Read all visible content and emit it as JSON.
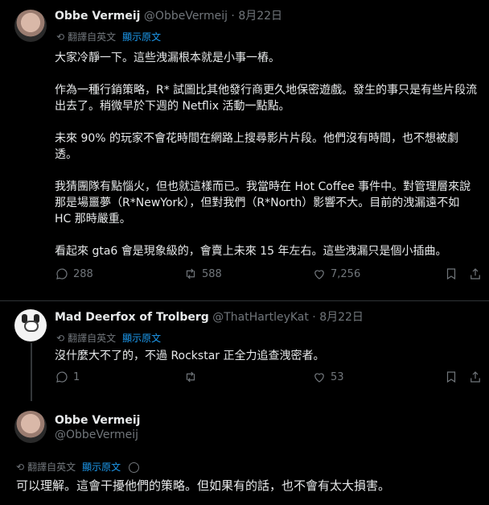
{
  "tweet1": {
    "name": "Obbe Vermeij",
    "handle": "@ObbeVermeij · 8月22日",
    "translate_label": "翻譯自英文",
    "show_original": "顯示原文",
    "text": "大家冷靜一下。這些洩漏根本就是小事一樁。\n\n作為一種行銷策略，R* 試圖比其他發行商更久地保密遊戲。發生的事只是有些片段流出去了。稍微早於下週的 Netflix 活動一點點。\n\n未來 90% 的玩家不會花時間在網路上搜尋影片片段。他們沒有時間，也不想被劇透。\n\n我猜團隊有點惱火，但也就這樣而已。我當時在 Hot Coffee 事件中。對管理層來說那是場噩夢（R*NewYork），但對我們（R*North）影響不大。目前的洩漏遠不如 HC 那時嚴重。\n\n看起來 gta6 會是現象級的，會賣上未來 15 年左右。這些洩漏只是個小插曲。",
    "replies": "288",
    "retweets": "588",
    "likes": "7,256",
    "icons": [
      "reply-icon",
      "retweet-icon",
      "like-icon",
      "bookmark-icon",
      "share-icon"
    ]
  },
  "tweet2": {
    "name": "Mad Deerfox of Trolberg",
    "handle": "@ThatHartleyKat · 8月22日",
    "translate_label": "翻譯自英文",
    "show_original": "顯示原文",
    "text": "沒什麼大不了的，不過 Rockstar 正全力追查洩密者。",
    "replies": "1",
    "retweets": "",
    "likes": "53"
  },
  "tweet3": {
    "name": "Obbe Vermeij",
    "handle": "@ObbeVermeij",
    "translate_label": "翻譯自英文",
    "show_original": "顯示原文",
    "text": "可以理解。這會干擾他們的策略。但如果有的話，也不會有太大損害。"
  }
}
